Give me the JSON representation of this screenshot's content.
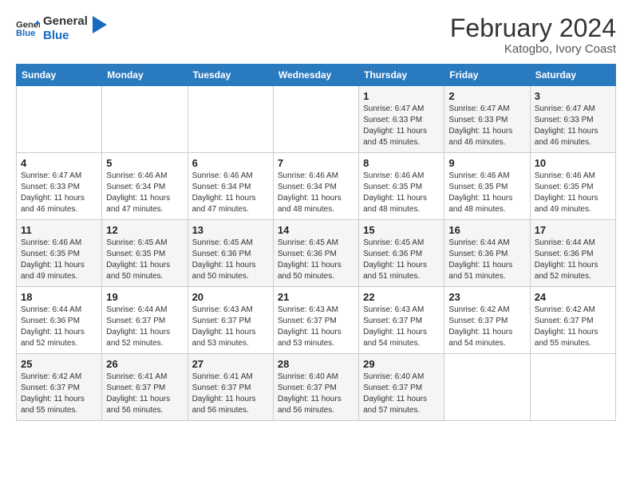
{
  "logo": {
    "line1": "General",
    "line2": "Blue"
  },
  "title": "February 2024",
  "subtitle": "Katogbo, Ivory Coast",
  "days_of_week": [
    "Sunday",
    "Monday",
    "Tuesday",
    "Wednesday",
    "Thursday",
    "Friday",
    "Saturday"
  ],
  "weeks": [
    [
      {
        "day": "",
        "info": ""
      },
      {
        "day": "",
        "info": ""
      },
      {
        "day": "",
        "info": ""
      },
      {
        "day": "",
        "info": ""
      },
      {
        "day": "1",
        "info": "Sunrise: 6:47 AM\nSunset: 6:33 PM\nDaylight: 11 hours and 45 minutes."
      },
      {
        "day": "2",
        "info": "Sunrise: 6:47 AM\nSunset: 6:33 PM\nDaylight: 11 hours and 46 minutes."
      },
      {
        "day": "3",
        "info": "Sunrise: 6:47 AM\nSunset: 6:33 PM\nDaylight: 11 hours and 46 minutes."
      }
    ],
    [
      {
        "day": "4",
        "info": "Sunrise: 6:47 AM\nSunset: 6:33 PM\nDaylight: 11 hours and 46 minutes."
      },
      {
        "day": "5",
        "info": "Sunrise: 6:46 AM\nSunset: 6:34 PM\nDaylight: 11 hours and 47 minutes."
      },
      {
        "day": "6",
        "info": "Sunrise: 6:46 AM\nSunset: 6:34 PM\nDaylight: 11 hours and 47 minutes."
      },
      {
        "day": "7",
        "info": "Sunrise: 6:46 AM\nSunset: 6:34 PM\nDaylight: 11 hours and 48 minutes."
      },
      {
        "day": "8",
        "info": "Sunrise: 6:46 AM\nSunset: 6:35 PM\nDaylight: 11 hours and 48 minutes."
      },
      {
        "day": "9",
        "info": "Sunrise: 6:46 AM\nSunset: 6:35 PM\nDaylight: 11 hours and 48 minutes."
      },
      {
        "day": "10",
        "info": "Sunrise: 6:46 AM\nSunset: 6:35 PM\nDaylight: 11 hours and 49 minutes."
      }
    ],
    [
      {
        "day": "11",
        "info": "Sunrise: 6:46 AM\nSunset: 6:35 PM\nDaylight: 11 hours and 49 minutes."
      },
      {
        "day": "12",
        "info": "Sunrise: 6:45 AM\nSunset: 6:35 PM\nDaylight: 11 hours and 50 minutes."
      },
      {
        "day": "13",
        "info": "Sunrise: 6:45 AM\nSunset: 6:36 PM\nDaylight: 11 hours and 50 minutes."
      },
      {
        "day": "14",
        "info": "Sunrise: 6:45 AM\nSunset: 6:36 PM\nDaylight: 11 hours and 50 minutes."
      },
      {
        "day": "15",
        "info": "Sunrise: 6:45 AM\nSunset: 6:36 PM\nDaylight: 11 hours and 51 minutes."
      },
      {
        "day": "16",
        "info": "Sunrise: 6:44 AM\nSunset: 6:36 PM\nDaylight: 11 hours and 51 minutes."
      },
      {
        "day": "17",
        "info": "Sunrise: 6:44 AM\nSunset: 6:36 PM\nDaylight: 11 hours and 52 minutes."
      }
    ],
    [
      {
        "day": "18",
        "info": "Sunrise: 6:44 AM\nSunset: 6:36 PM\nDaylight: 11 hours and 52 minutes."
      },
      {
        "day": "19",
        "info": "Sunrise: 6:44 AM\nSunset: 6:37 PM\nDaylight: 11 hours and 52 minutes."
      },
      {
        "day": "20",
        "info": "Sunrise: 6:43 AM\nSunset: 6:37 PM\nDaylight: 11 hours and 53 minutes."
      },
      {
        "day": "21",
        "info": "Sunrise: 6:43 AM\nSunset: 6:37 PM\nDaylight: 11 hours and 53 minutes."
      },
      {
        "day": "22",
        "info": "Sunrise: 6:43 AM\nSunset: 6:37 PM\nDaylight: 11 hours and 54 minutes."
      },
      {
        "day": "23",
        "info": "Sunrise: 6:42 AM\nSunset: 6:37 PM\nDaylight: 11 hours and 54 minutes."
      },
      {
        "day": "24",
        "info": "Sunrise: 6:42 AM\nSunset: 6:37 PM\nDaylight: 11 hours and 55 minutes."
      }
    ],
    [
      {
        "day": "25",
        "info": "Sunrise: 6:42 AM\nSunset: 6:37 PM\nDaylight: 11 hours and 55 minutes."
      },
      {
        "day": "26",
        "info": "Sunrise: 6:41 AM\nSunset: 6:37 PM\nDaylight: 11 hours and 56 minutes."
      },
      {
        "day": "27",
        "info": "Sunrise: 6:41 AM\nSunset: 6:37 PM\nDaylight: 11 hours and 56 minutes."
      },
      {
        "day": "28",
        "info": "Sunrise: 6:40 AM\nSunset: 6:37 PM\nDaylight: 11 hours and 56 minutes."
      },
      {
        "day": "29",
        "info": "Sunrise: 6:40 AM\nSunset: 6:37 PM\nDaylight: 11 hours and 57 minutes."
      },
      {
        "day": "",
        "info": ""
      },
      {
        "day": "",
        "info": ""
      }
    ]
  ]
}
